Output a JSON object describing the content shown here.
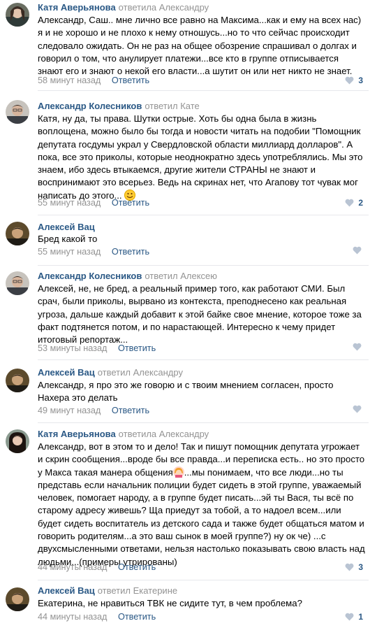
{
  "colors": {
    "link": "#2a5885",
    "muted": "#939393",
    "heart": "#b9c4d3",
    "separator": "#e7e8ec"
  },
  "comments": [
    {
      "author": "Катя Аверьянова",
      "replied": "ответила Александру",
      "text": "Александр, Саш.. мне лично все равно на Максима...как и ему на всех нас) я и не хорошо и не плохо к нему отношусь...но то что сейчас происходит следовало ожидать. Он не раз на общее обозрение спрашивал о долгах и говорил о том, что анулирует платежи...все кто в группе отписывается знают его и знают о некой его власти...а шутит он или нет никто не знает.",
      "time": "58 минут назад",
      "reply": "Ответить",
      "likes": "3",
      "icon": "heart-icon"
    },
    {
      "author": "Александр Колесников",
      "replied": "ответил Кате",
      "text": "Катя, ну да, ты права. Шутки острые. Хоть бы одна была в жизнь воплощена, можно было бы тогда и новости читать на подобии \"Помощник депутата госдумы украл у Свердловской области миллиард долларов\". А пока, все это приколы, которые неоднократно здесь употреблялись. Мы это знаем, ибо здесь втыкаемся, другие жители СТРАНЫ не знают и воспринимают это всерьез. Ведь на скринах нет, что Агапову тот чувак мог написать до этого...",
      "emoji": "smile-emoji",
      "time": "55 минут назад",
      "reply": "Ответить",
      "likes": "2",
      "icon": "heart-icon"
    },
    {
      "author": "Алексей Вац",
      "replied": "",
      "text": "Бред какой то",
      "time": "55 минут назад",
      "reply": "Ответить",
      "likes": "",
      "icon": "heart-icon"
    },
    {
      "author": "Александр Колесников",
      "replied": "ответил Алексею",
      "text": "Алексей, не, не бред, а реальный пример того, как работают СМИ. Был срач, были приколы, вырвано из контекста, преподнесено как реальная угроза, дальше каждый добавит к этой байке свое мнение, которое тоже за факт подтянется потом, и по нарастающей. Интересно к чему придет итоговый репортаж...",
      "time": "53 минуты назад",
      "reply": "Ответить",
      "likes": "",
      "icon": "heart-icon"
    },
    {
      "author": "Алексей Вац",
      "replied": "ответил Александру",
      "text": "Александр, я про это же говорю и с твоим мнением согласен, просто Нахера это делать",
      "time": "49 минут назад",
      "reply": "Ответить",
      "likes": "",
      "icon": "heart-icon"
    },
    {
      "author": "Катя Аверьянова",
      "replied": "ответила Александру",
      "text_before": "Александр, вот в этом то и дело! Так и пишут помощник депутата угрожает и скрин сообщения...вроде бы все правда...и переписка есть.. но это просто у Макса такая манера общения",
      "emoji": "woman-gesture-emoji",
      "text_after": "...мы понимаем, что все люди...но ты представь если начальник полиции будет сидеть в этой группе, уважаемый человек, помогает народу, а в группе будет писать...эй ты Вася, ты всё по старому адресу живешь? Ща приедут за тобой, а то надоел всем...или будет сидеть воспитатель из детского сада и также будет общаться матом и говорить родителям...а это ваш сынок в моей группе?) ну ок че) ...с двухсмысленными ответами, нельзя настолько показывать свою власть над людьми...(примеры утрированы)",
      "time": "44 минуты назад",
      "reply": "Ответить",
      "likes": "3",
      "icon": "heart-icon"
    },
    {
      "author": "Алексей Вац",
      "replied": "ответил Екатерине",
      "text": "Екатерина, не нравиться ТВК не сидите тут, в чем проблема?",
      "time": "44 минуты назад",
      "reply": "Ответить",
      "likes": "1",
      "icon": "heart-icon"
    }
  ]
}
